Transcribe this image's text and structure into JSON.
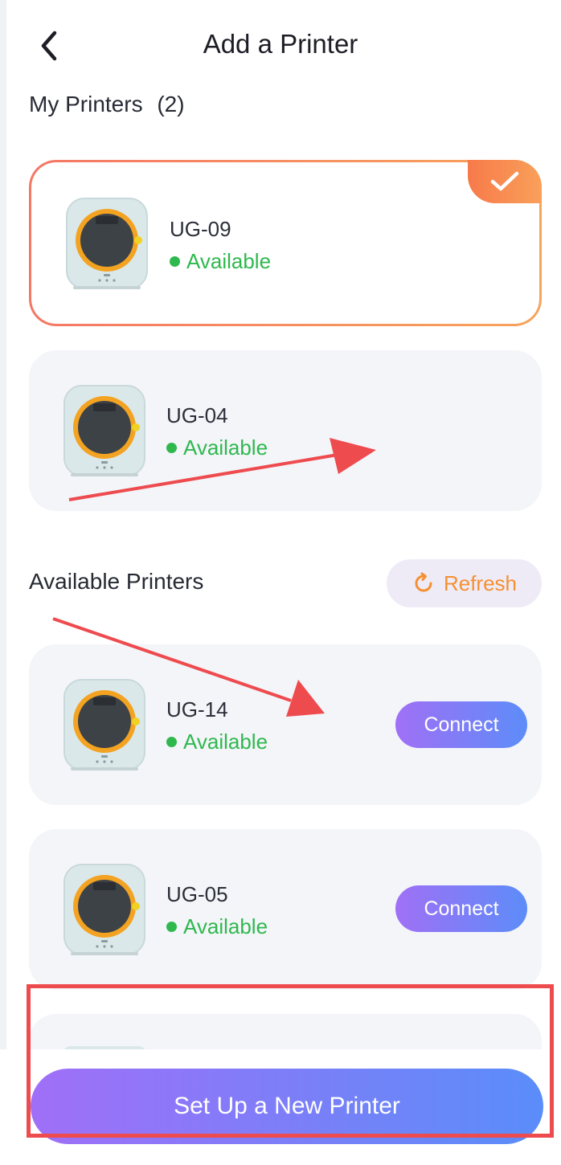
{
  "header": {
    "title": "Add a Printer",
    "back_icon": "chevron-left-icon"
  },
  "my_printers": {
    "title": "My Printers",
    "count": "(2)",
    "items": [
      {
        "name": "UG-09",
        "status": "Available",
        "selected": true
      },
      {
        "name": "UG-04",
        "status": "Available",
        "selected": false
      }
    ]
  },
  "available_printers": {
    "title": "Available Printers",
    "refresh_label": "Refresh",
    "items": [
      {
        "name": "UG-14",
        "status": "Available",
        "action": "Connect"
      },
      {
        "name": "UG-05",
        "status": "Available",
        "action": "Connect"
      }
    ]
  },
  "footer": {
    "setup_label": "Set Up a New Printer"
  },
  "colors": {
    "status_green": "#2fb84e",
    "accent_orange": "#f59032",
    "gradient_start": "#a06ff7",
    "gradient_end": "#5a8df9",
    "annotation_red": "#ee4b4f"
  }
}
